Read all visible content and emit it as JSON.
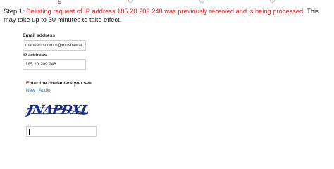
{
  "header_fragment": "g",
  "step": {
    "prefix": "Step 1:",
    "message": "Delisting request of IP address 185.20.209.248 was previously received and is being processed.",
    "suffix": "This may take up to 30 minutes to take effect."
  },
  "form": {
    "email": {
      "label": "Email address",
      "value": "maheen.soomro@mushawar.cc"
    },
    "ip": {
      "label": "IP address",
      "value": "185.20.209.248"
    },
    "captcha": {
      "label": "Enter the characters you see",
      "new_link": "New",
      "separator": "|",
      "audio_link": "Audio",
      "image_text": "JNAPDXL",
      "answer_value": ""
    }
  },
  "colors": {
    "error_text": "#c62828",
    "link": "#2b6cb0",
    "captcha_ink": "#1c2f86"
  }
}
